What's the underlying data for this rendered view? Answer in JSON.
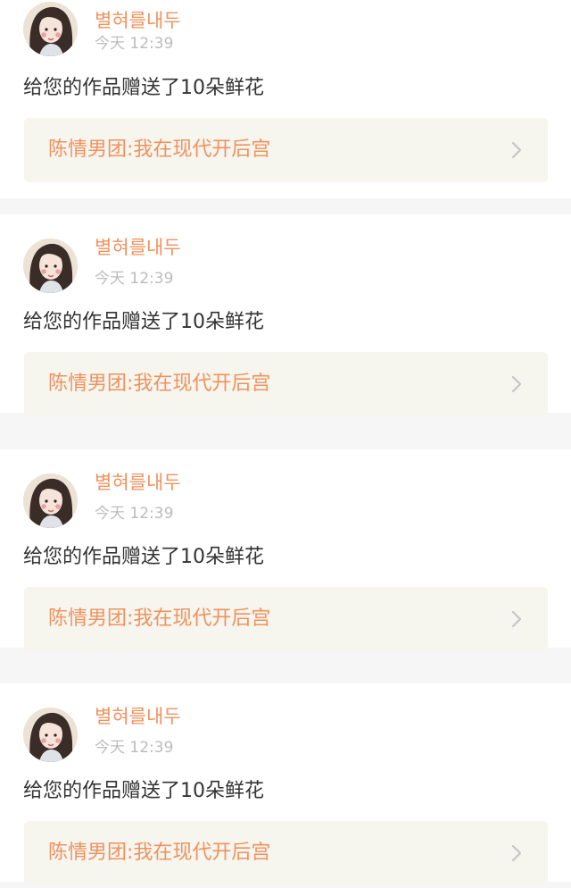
{
  "notifications": [
    {
      "username": "별혀를내두",
      "timestamp": "今天 12:39",
      "message": "给您的作品赠送了10朵鲜花",
      "work_title": "陈情男团:我在现代开后宫"
    },
    {
      "username": "별혀를내두",
      "timestamp": "今天 12:39",
      "message": "给您的作品赠送了10朵鲜花",
      "work_title": "陈情男团:我在现代开后宫"
    },
    {
      "username": "별혀를내두",
      "timestamp": "今天 12:39",
      "message": "给您的作品赠送了10朵鲜花",
      "work_title": "陈情男团:我在现代开后宫"
    },
    {
      "username": "별혀를내두",
      "timestamp": "今天 12:39",
      "message": "给您的作品赠送了10朵鲜花",
      "work_title": "陈情男团:我在现代开后宫"
    }
  ],
  "colors": {
    "accent": "#f0925e",
    "text": "#333333",
    "muted": "#bcbcbc",
    "link_bg": "#f6f5ee",
    "page_bg": "#f6f6f6"
  },
  "icons": {
    "avatar": "avatar-photo",
    "chevron": "chevron-right-icon"
  }
}
